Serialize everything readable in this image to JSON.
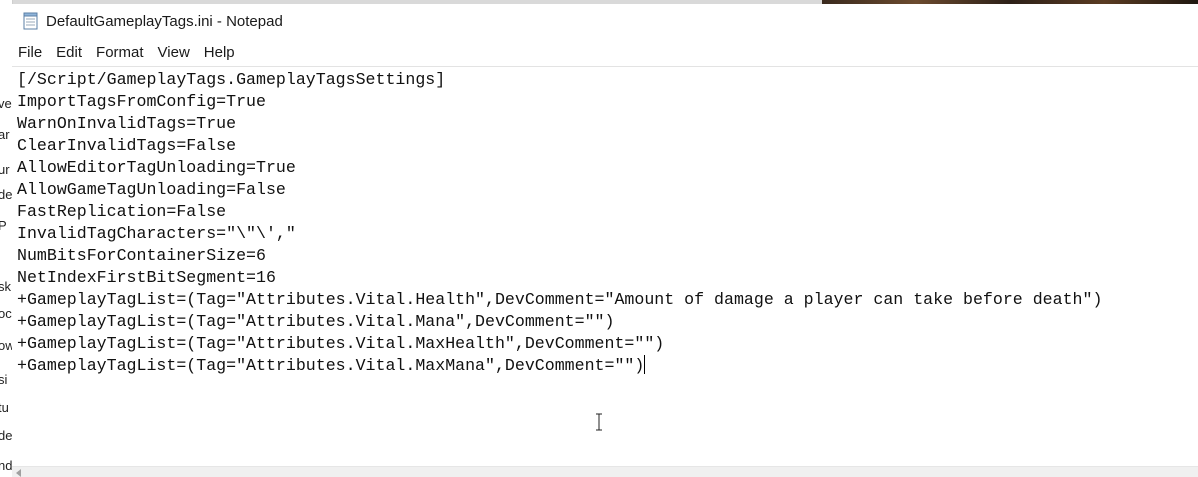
{
  "window": {
    "title": "DefaultGameplayTags.ini - Notepad"
  },
  "menu": [
    "File",
    "Edit",
    "Format",
    "View",
    "Help"
  ],
  "editor": {
    "lines": [
      "[/Script/GameplayTags.GameplayTagsSettings]",
      "ImportTagsFromConfig=True",
      "WarnOnInvalidTags=True",
      "ClearInvalidTags=False",
      "AllowEditorTagUnloading=True",
      "AllowGameTagUnloading=False",
      "FastReplication=False",
      "InvalidTagCharacters=\"\\\"\\',\"",
      "NumBitsForContainerSize=6",
      "NetIndexFirstBitSegment=16",
      "+GameplayTagList=(Tag=\"Attributes.Vital.Health\",DevComment=\"Amount of damage a player can take before death\")",
      "+GameplayTagList=(Tag=\"Attributes.Vital.Mana\",DevComment=\"\")",
      "+GameplayTagList=(Tag=\"Attributes.Vital.MaxHealth\",DevComment=\"\")",
      "+GameplayTagList=(Tag=\"Attributes.Vital.MaxMana\",DevComment=\"\")"
    ]
  },
  "background_window": {
    "snippets": [
      "ve",
      "ar",
      "ur",
      "de",
      "P",
      "sk",
      "oc",
      "ow",
      "si",
      "tu",
      "de",
      "nd"
    ]
  },
  "colors": {
    "text": "#111111",
    "window_bg": "#ffffff"
  }
}
